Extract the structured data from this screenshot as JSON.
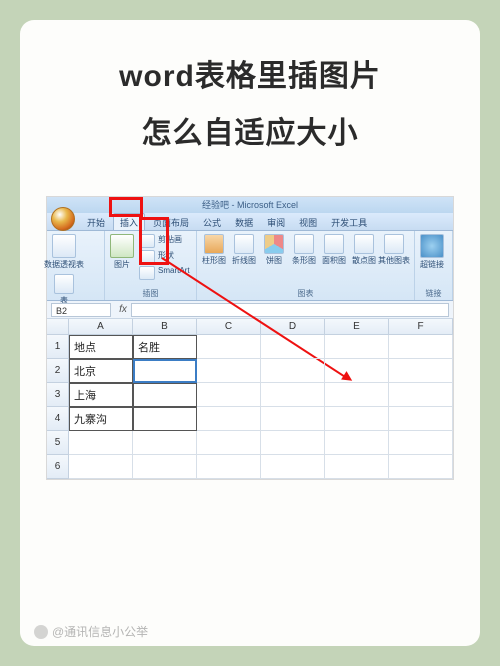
{
  "title_line1": "word表格里插图片",
  "title_line2": "怎么自适应大小",
  "window_title": "经验吧 - Microsoft Excel",
  "tabs": [
    "开始",
    "插入",
    "页面布局",
    "公式",
    "数据",
    "审阅",
    "视图",
    "开发工具"
  ],
  "active_tab_index": 1,
  "ribbon": {
    "group_tables": {
      "label": "表",
      "items": [
        "数据透视表",
        "表"
      ]
    },
    "group_illustrations": {
      "label": "插图",
      "items": [
        "图片",
        "剪贴画",
        "形状",
        "SmartArt"
      ]
    },
    "group_charts": {
      "label": "图表",
      "items": [
        "柱形图",
        "折线图",
        "饼图",
        "条形图",
        "面积图",
        "散点图",
        "其他图表"
      ]
    },
    "group_links": {
      "label": "链接",
      "items": [
        "超链接"
      ]
    }
  },
  "namebox": "B2",
  "columns": [
    "A",
    "B",
    "C",
    "D",
    "E",
    "F"
  ],
  "rows": [
    "1",
    "2",
    "3",
    "4",
    "5",
    "6"
  ],
  "table": {
    "header": [
      "地点",
      "名胜"
    ],
    "data": [
      [
        "北京",
        ""
      ],
      [
        "上海",
        ""
      ],
      [
        "九寨沟",
        ""
      ]
    ]
  },
  "watermark": "@通讯信息小公举"
}
